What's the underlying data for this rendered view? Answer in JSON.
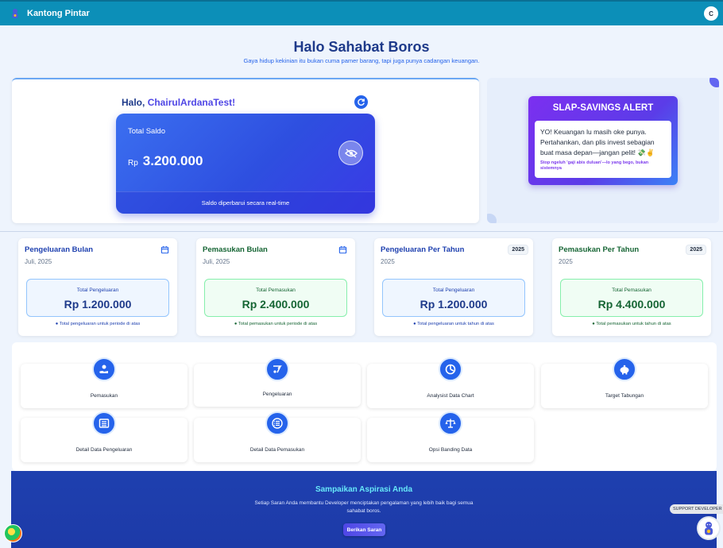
{
  "app": {
    "brand": "Kantong Pintar",
    "avatar_initial": "C"
  },
  "hero": {
    "title": "Halo Sahabat Boros",
    "subtitle": "Gaya hidup kekinian itu bukan cuma pamer barang, tapi juga punya cadangan keuangan."
  },
  "greeting": {
    "prefix": "Halo,",
    "username": "ChairulArdanaTest!"
  },
  "balance": {
    "label": "Total Saldo",
    "currency": "Rp",
    "amount": "3.200.000",
    "footer": "Saldo diperbarui secara real-time"
  },
  "alert": {
    "title": "SLAP-SAVINGS ALERT",
    "message": "YO! Keuangan lu masih oke punya. Pertahankan, dan plis invest sebagian buat masa depan—jangan pelit! 💸✌",
    "note": "Stop ngeluh 'gaji abis duluan'—lo yang bego, bukan sistemnya"
  },
  "stats": [
    {
      "title": "Pengeluaran Bulan",
      "period": "Juli, 2025",
      "box_label": "Total Pengeluaran",
      "value": "Rp 1.200.000",
      "note": "Total pengeluaran untuk periode di atas",
      "tone": "blue"
    },
    {
      "title": "Pemasukan Bulan",
      "period": "Juli, 2025",
      "box_label": "Total Pemasukan",
      "value": "Rp 2.400.000",
      "note": "Total pemasukan untuk periode di atas",
      "tone": "green"
    },
    {
      "title": "Pengeluaran Per Tahun",
      "period": "2025",
      "year_badge": "2025",
      "box_label": "Total Pengeluaran",
      "value": "Rp 1.200.000",
      "note": "Total pengeluaran untuk tahun di atas",
      "tone": "blue"
    },
    {
      "title": "Pemasukan Per Tahun",
      "period": "2025",
      "year_badge": "2025",
      "box_label": "Total Pemasukan",
      "value": "Rp 4.400.000",
      "note": "Total pemasukan untuk tahun di atas",
      "tone": "green"
    }
  ],
  "menu": [
    {
      "label": "Pemasukan",
      "icon": "income-hand-icon"
    },
    {
      "label": "Pengeluaran",
      "icon": "expense-icon"
    },
    {
      "label": "Analysist Data Chart",
      "icon": "pie-chart-icon"
    },
    {
      "label": "Target Tabungan",
      "icon": "piggy-bank-icon"
    },
    {
      "label": "Detail Data Pengeluaran",
      "icon": "list-detail-icon"
    },
    {
      "label": "Detail Data Pemasukan",
      "icon": "list-icon"
    },
    {
      "label": "Opsi Banding Data",
      "icon": "scale-icon"
    }
  ],
  "feedback": {
    "title": "Sampaikan Aspirasi Anda",
    "text": "Setiap Saran Anda membantu Developer menciptakan pengalaman yang lebih baik bagi semua sahabat boros.",
    "button": "Berikan Saran"
  },
  "support": {
    "label": "SUPPORT DEVELOPER"
  },
  "colors": {
    "navbar": "#0c8fb8",
    "primary": "#2563eb",
    "heading": "#1e3a8a",
    "income": "#166534",
    "footer": "#1e40af"
  }
}
